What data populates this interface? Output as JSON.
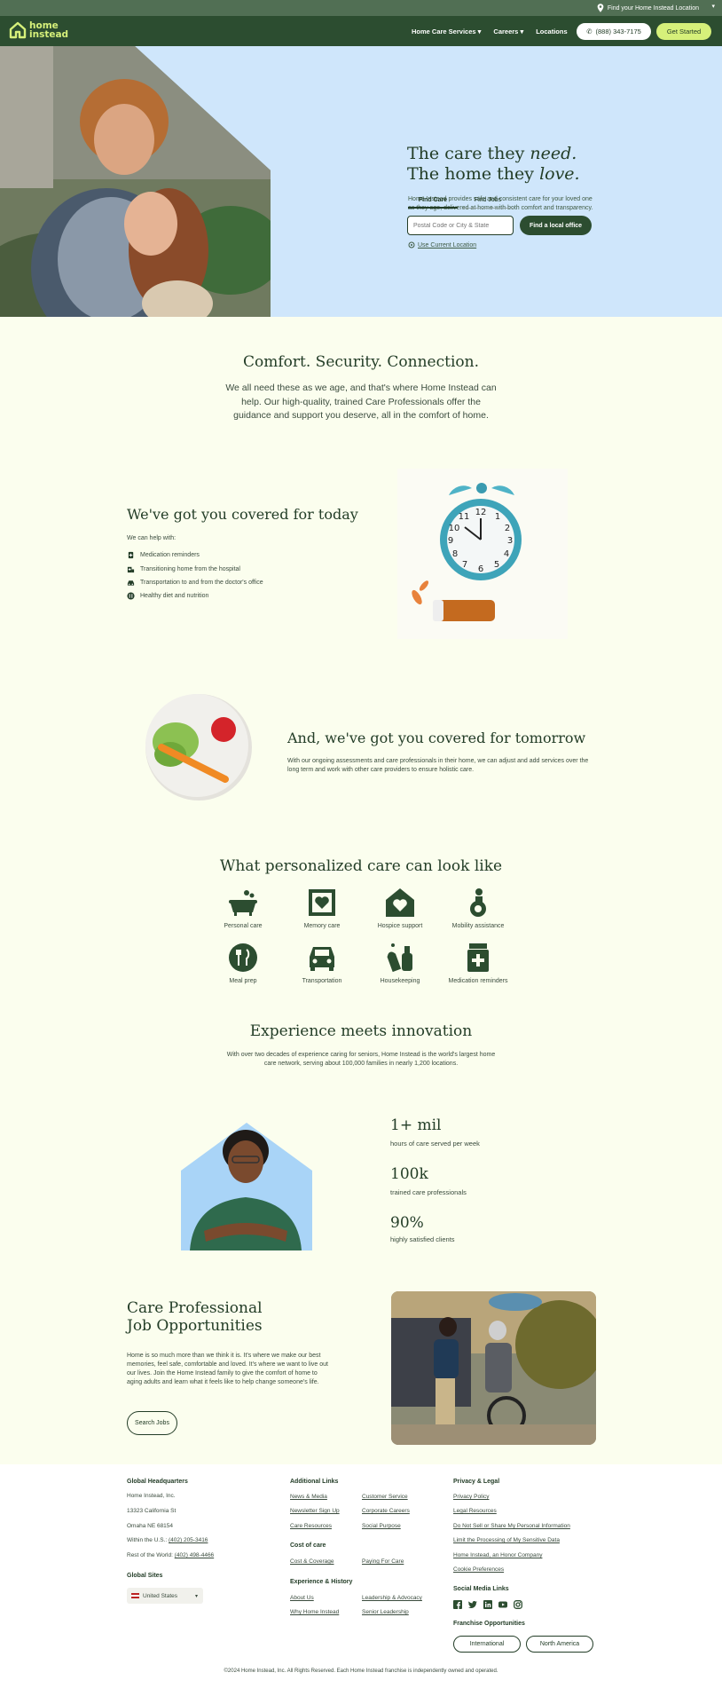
{
  "topbar": {
    "location_label": "Find your Home Instead Location"
  },
  "nav": {
    "logo_line1": "home",
    "logo_line2": "instead",
    "links": [
      "Home Care Services",
      "Careers",
      "Locations"
    ],
    "phone": "(888) 343-7175",
    "cta": "Get Started"
  },
  "hero": {
    "title_line1_plain": "The care they ",
    "title_line1_em": "need.",
    "title_line2_plain": "The home they ",
    "title_line2_em": "love.",
    "description": "Home Instead provides safe and consistent care for your loved one as they age, delivered at home with both comfort and transparency.",
    "tabs": [
      "Find Care",
      "Find Jobs"
    ],
    "search_placeholder": "Postal Code or City & State",
    "search_button": "Find a local office",
    "current_location": "Use Current Location"
  },
  "comfort": {
    "title": "Comfort. Security. Connection.",
    "text": "We all need these as we age, and that's where Home Instead can help. Our high-quality, trained Care Professionals offer the guidance and support you deserve, all in the comfort of home."
  },
  "today": {
    "title": "We've got you covered for today",
    "subtitle": "We can help with:",
    "items": [
      "Medication reminders",
      "Transitioning home from the hospital",
      "Transportation to and from the doctor's office",
      "Healthy diet and nutrition"
    ]
  },
  "tomorrow": {
    "title": "And, we've got you covered for tomorrow",
    "description": "With our ongoing assessments and care professionals in their home, we can adjust and add services over the long term and work with other care providers to ensure holistic care."
  },
  "care": {
    "title": "What personalized care can look like",
    "items": [
      "Personal care",
      "Memory care",
      "Hospice support",
      "Mobility assistance",
      "Meal prep",
      "Transportation",
      "Housekeeping",
      "Medication reminders"
    ]
  },
  "experience": {
    "title": "Experience meets innovation",
    "description": "With over two decades of experience caring for seniors, Home Instead is the world's largest home care network, serving about 100,000 families in nearly 1,200 locations.",
    "stats": [
      {
        "num": "1+ mil",
        "label": "hours of care served per week"
      },
      {
        "num": "100k",
        "label": "trained care professionals"
      },
      {
        "num": "90%",
        "label": "highly satisfied clients"
      }
    ]
  },
  "jobs": {
    "title_line1": "Care Professional",
    "title_line2": "Job Opportunities",
    "description": "Home is so much more than we think it is. It's where we make our best memories, feel safe, comfortable and loved. It's where we want to live out our lives. Join the Home Instead family to give the comfort of home to aging adults and learn what it feels like to help change someone's life.",
    "button": "Search Jobs"
  },
  "footer": {
    "hq_title": "Global Headquarters",
    "hq_lines": [
      "Home Instead, Inc.",
      "13323 California St",
      "Omaha NE 68154"
    ],
    "phone_us_label": "Within the U.S.: ",
    "phone_us": "(402) 205-3416",
    "phone_world_label": "Rest of the World: ",
    "phone_world": "(402) 498-4466",
    "sites_title": "Global Sites",
    "site_selected": "United States",
    "additional_title": "Additional Links",
    "additional_col1": [
      "News & Media",
      "Newsletter Sign Up",
      "Care Resources"
    ],
    "additional_col2": [
      "Customer Service",
      "Corporate Careers",
      "Social Purpose"
    ],
    "cost_title": "Cost of care",
    "cost_col1": [
      "Cost & Coverage"
    ],
    "cost_col2": [
      "Paying For Care"
    ],
    "exp_title": "Experience & History",
    "exp_col1": [
      "About Us",
      "Why Home Instead"
    ],
    "exp_col2": [
      "Leadership & Advocacy",
      "Senior Leadership"
    ],
    "privacy_title": "Privacy & Legal",
    "privacy_links": [
      "Privacy Policy",
      "Legal Resources",
      "Do Not Sell or Share My Personal Information",
      "Limit the Processing of My Sensitive Data",
      "Home Instead, an Honor Company",
      "Cookie Preferences"
    ],
    "social_title": "Social Media Links",
    "social_icons": [
      "facebook-icon",
      "twitter-icon",
      "linkedin-icon",
      "youtube-icon",
      "instagram-icon"
    ],
    "franchise_title": "Franchise Opportunities",
    "franchise_buttons": [
      "International",
      "North America"
    ],
    "copyright": "©2024 Home Instead, Inc. All Rights Reserved. Each Home Instead franchise is independently owned and operated."
  },
  "colors": {
    "dark_green": "#2c4d30",
    "lime": "#d6f07a",
    "hero_blue": "#cfe6fb",
    "cream": "#fbfeee"
  }
}
